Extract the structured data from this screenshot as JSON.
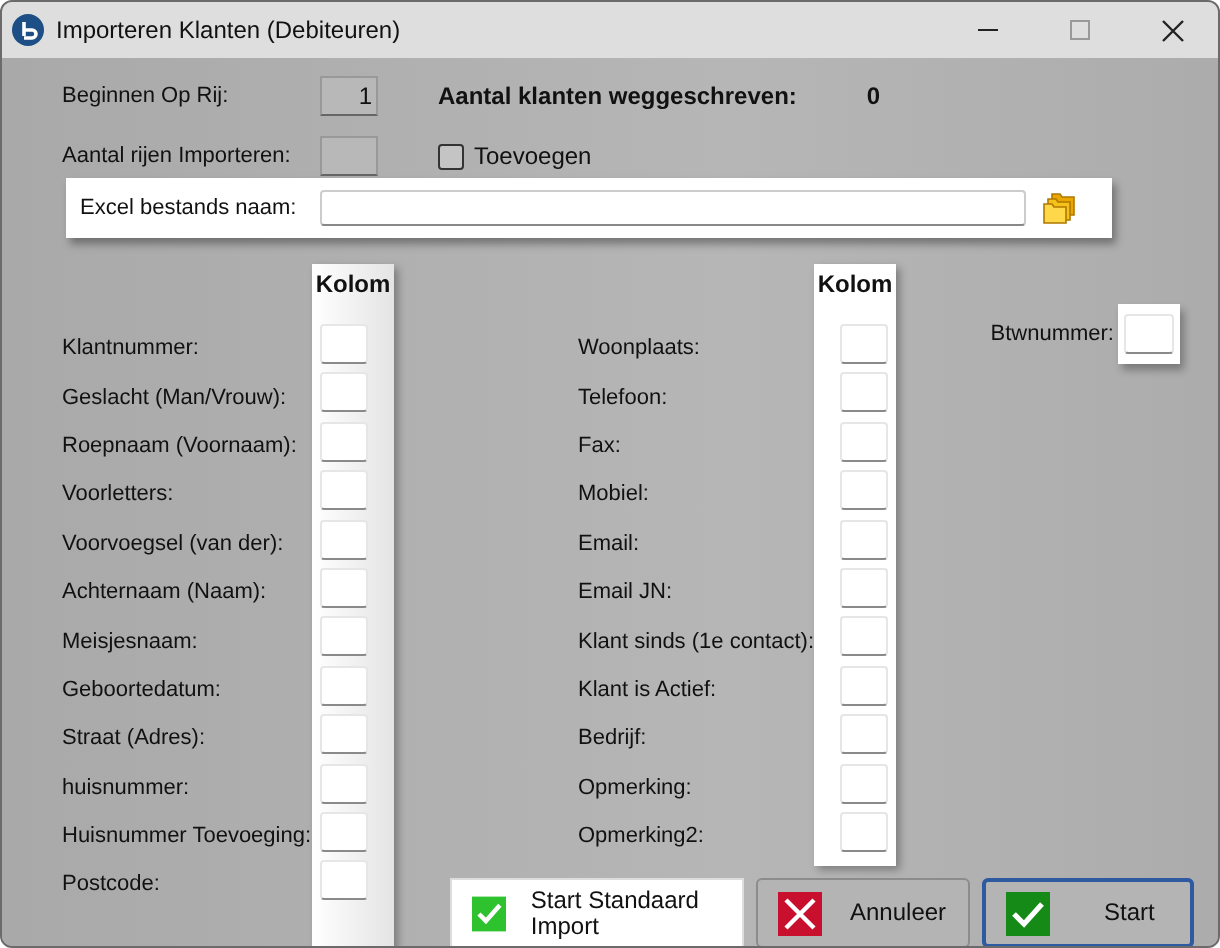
{
  "window": {
    "title": "Importeren Klanten (Debiteuren)"
  },
  "start_row": {
    "label": "Beginnen Op Rij:",
    "value": "1"
  },
  "written": {
    "label": "Aantal klanten weggeschreven:",
    "value": "0"
  },
  "rows_to_import": {
    "label": "Aantal rijen Importeren:"
  },
  "append": {
    "label": "Toevoegen",
    "checked": false
  },
  "excel_file": {
    "label": "Excel bestands naam:"
  },
  "columns_left": {
    "header": "Kolom",
    "fields": [
      "Klantnummer:",
      "Geslacht (Man/Vrouw):",
      "Roepnaam (Voornaam):",
      "Voorletters:",
      "Voorvoegsel (van der):",
      "Achternaam (Naam):",
      "Meisjesnaam:",
      "Geboortedatum:",
      "Straat (Adres):",
      "huisnummer:",
      "Huisnummer Toevoeging:",
      "Postcode:"
    ]
  },
  "columns_right": {
    "header": "Kolom",
    "fields": [
      "Woonplaats:",
      "Telefoon:",
      "Fax:",
      "Mobiel:",
      "Email:",
      "Email JN:",
      "Klant sinds (1e contact):",
      "Klant is Actief:",
      "Bedrijf:",
      "Opmerking:",
      "Opmerking2:"
    ]
  },
  "vat": {
    "label": "Btwnummer:"
  },
  "buttons": [
    {
      "label": "Start Standaard Import",
      "kind": "import",
      "focused": false
    },
    {
      "label": "Annuleer",
      "kind": "cancel",
      "focused": false
    },
    {
      "label": "Start",
      "kind": "start",
      "focused": true
    }
  ]
}
